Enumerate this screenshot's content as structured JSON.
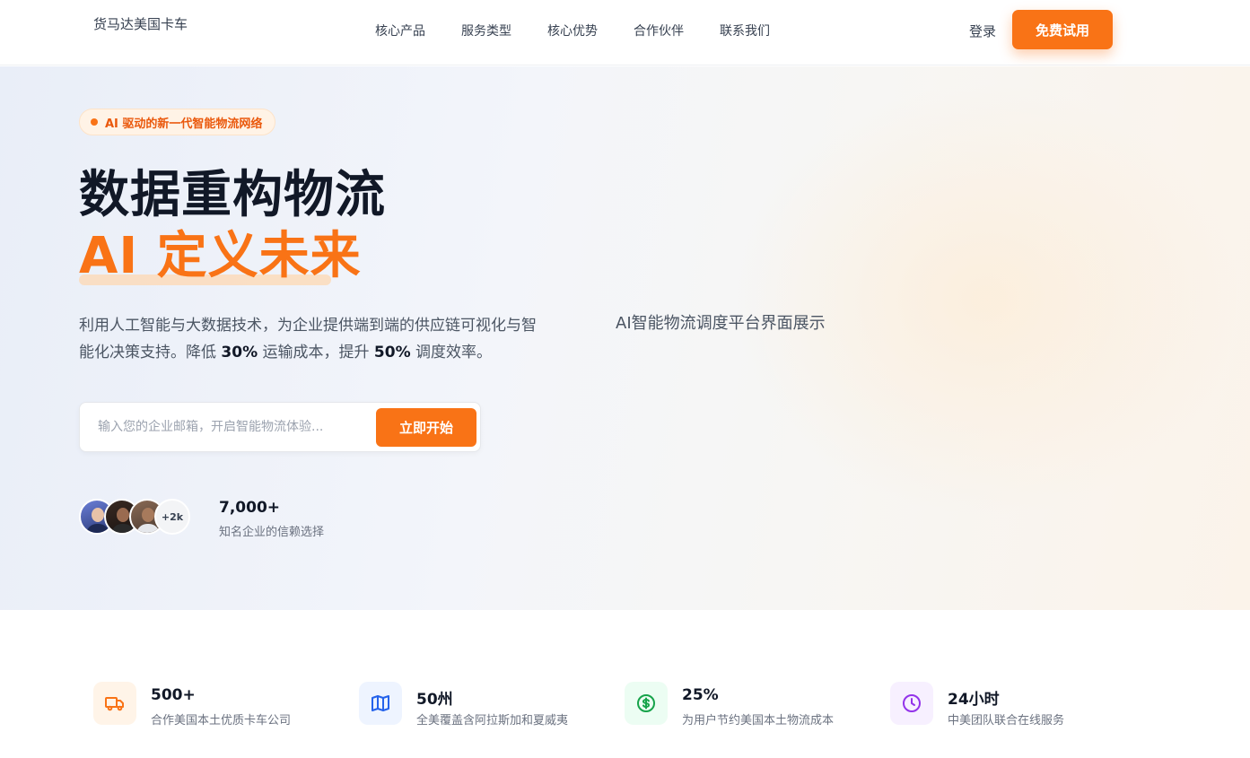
{
  "header": {
    "brand": "货马达美国卡车",
    "nav": [
      "核心产品",
      "服务类型",
      "核心优势",
      "合作伙伴",
      "联系我们"
    ],
    "login": "登录",
    "trial_button": "免费试用"
  },
  "hero": {
    "badge": "AI 驱动的新一代智能物流网络",
    "title_line1": "数据重构物流",
    "title_line2": "AI 定义未来",
    "desc_part1": "利用人工智能与大数据技术，为企业提供端到端的供应链可视化与智能化决策支持。降低 ",
    "desc_strong1": "30%",
    "desc_part2": " 运输成本，提升 ",
    "desc_strong2": "50%",
    "desc_part3": " 调度效率。",
    "email_placeholder": "输入您的企业邮箱，开启智能物流体验...",
    "start_button": "立即开始",
    "avatar_more": "+2k",
    "trust_count": "7,000+",
    "trust_label": "知名企业的信赖选择",
    "platform_image_alt": "AI智能物流调度平台界面展示"
  },
  "stats": [
    {
      "icon": "truck-icon",
      "color": "#f97316",
      "bg": "#fff4e8",
      "value": "500+",
      "label": "合作美国本土优质卡车公司"
    },
    {
      "icon": "map-icon",
      "color": "#2563eb",
      "bg": "#eef4ff",
      "value": "50州",
      "label": "全美覆盖含阿拉斯加和夏威夷"
    },
    {
      "icon": "dollar-icon",
      "color": "#16a34a",
      "bg": "#ecfdf3",
      "value": "25%",
      "label": "为用户节约美国本土物流成本"
    },
    {
      "icon": "clock-icon",
      "color": "#9333ea",
      "bg": "#f7f0ff",
      "value": "24小时",
      "label": "中美团队联合在线服务"
    }
  ]
}
